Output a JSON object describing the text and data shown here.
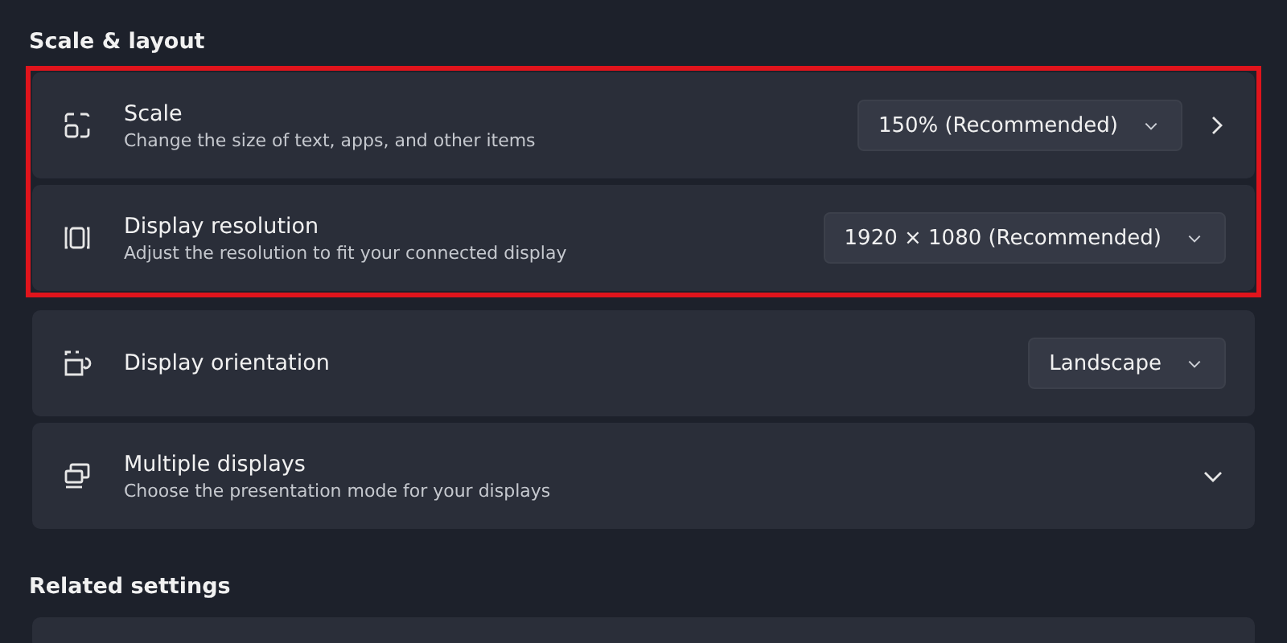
{
  "sections": [
    {
      "title": "Scale & layout",
      "rows": [
        {
          "title": "Scale",
          "subtitle": "Change the size of text, apps, and other items",
          "kind": "dropdown_link",
          "dropdown": "150% (Recommended)",
          "highlighted": true
        },
        {
          "title": "Display resolution",
          "subtitle": "Adjust the resolution to fit your connected display",
          "kind": "dropdown",
          "dropdown": "1920 × 1080 (Recommended)",
          "highlighted": true
        },
        {
          "title": "Display orientation",
          "kind": "dropdown",
          "dropdown": "Landscape",
          "highlighted": false
        },
        {
          "title": "Multiple displays",
          "subtitle": "Choose the presentation mode for your displays",
          "kind": "expander",
          "highlighted": false
        }
      ]
    },
    {
      "title": "Related settings"
    }
  ]
}
